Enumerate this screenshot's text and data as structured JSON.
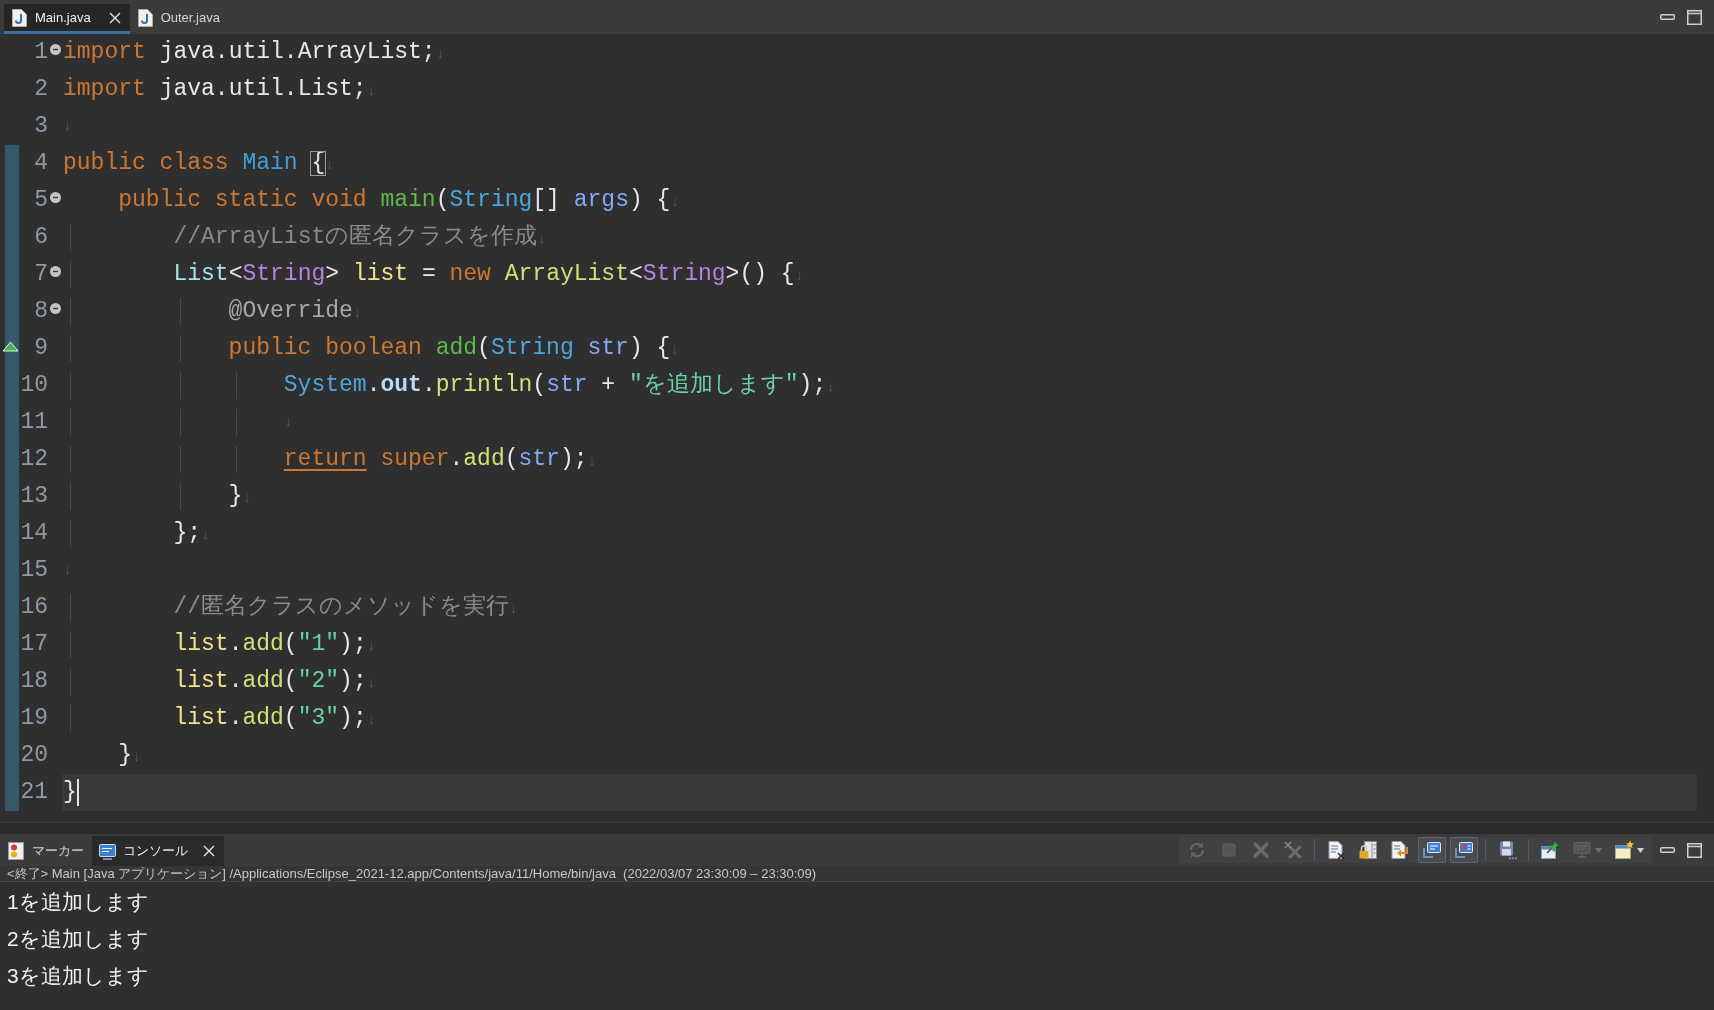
{
  "editor_tabs": [
    {
      "label": "Main.java",
      "selected": true
    },
    {
      "label": "Outer.java",
      "selected": false
    }
  ],
  "editor": {
    "lines": [
      {
        "number": "1",
        "fold": true,
        "override": false,
        "range": false,
        "current": false,
        "tokens": [
          {
            "kind": "keyword",
            "text": "import"
          },
          {
            "kind": "plain",
            "text": " java.util.ArrayList;"
          },
          {
            "kind": "eol",
            "text": "↓"
          }
        ]
      },
      {
        "number": "2",
        "fold": false,
        "override": false,
        "range": false,
        "current": false,
        "tokens": [
          {
            "kind": "keyword",
            "text": "import"
          },
          {
            "kind": "plain",
            "text": " java.util.List;"
          },
          {
            "kind": "eol",
            "text": "↓"
          }
        ]
      },
      {
        "number": "3",
        "fold": false,
        "override": false,
        "range": false,
        "current": false,
        "tokens": [
          {
            "kind": "eol",
            "text": "↓"
          }
        ]
      },
      {
        "number": "4",
        "fold": false,
        "override": false,
        "range": true,
        "current": false,
        "tokens": [
          {
            "kind": "keyword",
            "text": "public class "
          },
          {
            "kind": "class_name",
            "text": "Main "
          },
          {
            "kind": "bracket_match",
            "text": "{"
          },
          {
            "kind": "eol",
            "text": "↓"
          }
        ]
      },
      {
        "number": "5",
        "fold": true,
        "override": false,
        "range": true,
        "current": false,
        "indent_guides": [
          false
        ],
        "tokens": [
          {
            "kind": "keyword",
            "text": "public static void "
          },
          {
            "kind": "method_decl",
            "text": "main"
          },
          {
            "kind": "plain",
            "text": "("
          },
          {
            "kind": "type",
            "text": "String"
          },
          {
            "kind": "plain",
            "text": "[] "
          },
          {
            "kind": "param",
            "text": "args"
          },
          {
            "kind": "plain",
            "text": ") {"
          },
          {
            "kind": "eol",
            "text": "↓"
          }
        ]
      },
      {
        "number": "6",
        "fold": false,
        "override": false,
        "range": true,
        "current": false,
        "indent_guides": [
          true,
          false
        ],
        "tokens": [
          {
            "kind": "comment",
            "text": "//ArrayListの匿名クラスを作成"
          },
          {
            "kind": "eol",
            "text": "↓"
          }
        ]
      },
      {
        "number": "7",
        "fold": true,
        "override": false,
        "range": true,
        "current": false,
        "indent_guides": [
          true,
          false
        ],
        "tokens": [
          {
            "kind": "local_type",
            "text": "List"
          },
          {
            "kind": "plain",
            "text": "<"
          },
          {
            "kind": "generic",
            "text": "String"
          },
          {
            "kind": "plain",
            "text": "> "
          },
          {
            "kind": "local_var",
            "text": "list"
          },
          {
            "kind": "plain",
            "text": " = "
          },
          {
            "kind": "keyword",
            "text": "new "
          },
          {
            "kind": "constructor",
            "text": "ArrayList"
          },
          {
            "kind": "plain",
            "text": "<"
          },
          {
            "kind": "generic",
            "text": "String"
          },
          {
            "kind": "plain",
            "text": ">() {"
          },
          {
            "kind": "eol",
            "text": "↓"
          }
        ]
      },
      {
        "number": "8",
        "fold": true,
        "override": false,
        "range": true,
        "current": false,
        "indent_guides": [
          true,
          false,
          true
        ],
        "tokens": [
          {
            "kind": "annotation",
            "text": "@Override"
          },
          {
            "kind": "eol",
            "text": "↓"
          }
        ]
      },
      {
        "number": "9",
        "fold": false,
        "override": true,
        "range": true,
        "current": false,
        "indent_guides": [
          true,
          false,
          true
        ],
        "tokens": [
          {
            "kind": "keyword",
            "text": "public boolean "
          },
          {
            "kind": "method_decl",
            "text": "add"
          },
          {
            "kind": "plain",
            "text": "("
          },
          {
            "kind": "type",
            "text": "String "
          },
          {
            "kind": "param",
            "text": "str"
          },
          {
            "kind": "plain",
            "text": ") {"
          },
          {
            "kind": "eol",
            "text": "↓"
          }
        ]
      },
      {
        "number": "10",
        "fold": false,
        "override": false,
        "range": true,
        "current": false,
        "indent_guides": [
          true,
          false,
          true,
          true
        ],
        "tokens": [
          {
            "kind": "type",
            "text": "System"
          },
          {
            "kind": "plain",
            "text": "."
          },
          {
            "kind": "field",
            "text": "out"
          },
          {
            "kind": "plain",
            "text": "."
          },
          {
            "kind": "method_call",
            "text": "println"
          },
          {
            "kind": "plain",
            "text": "("
          },
          {
            "kind": "param",
            "text": "str"
          },
          {
            "kind": "plain",
            "text": " + "
          },
          {
            "kind": "string",
            "text": "\"を追加します\""
          },
          {
            "kind": "plain",
            "text": ");"
          },
          {
            "kind": "eol",
            "text": "↓"
          }
        ]
      },
      {
        "number": "11",
        "fold": false,
        "override": false,
        "range": true,
        "current": false,
        "indent_guides": [
          true,
          false,
          true,
          true
        ],
        "tokens": [
          {
            "kind": "eol",
            "text": "↓"
          }
        ]
      },
      {
        "number": "12",
        "fold": false,
        "override": false,
        "range": true,
        "current": false,
        "indent_guides": [
          true,
          false,
          true,
          true
        ],
        "tokens": [
          {
            "kind": "return_keyword",
            "text": "return"
          },
          {
            "kind": "keyword",
            "text": " super"
          },
          {
            "kind": "plain",
            "text": "."
          },
          {
            "kind": "method_call",
            "text": "add"
          },
          {
            "kind": "plain",
            "text": "("
          },
          {
            "kind": "param",
            "text": "str"
          },
          {
            "kind": "plain",
            "text": ");"
          },
          {
            "kind": "eol",
            "text": "↓"
          }
        ]
      },
      {
        "number": "13",
        "fold": false,
        "override": false,
        "range": true,
        "current": false,
        "indent_guides": [
          true,
          false,
          true
        ],
        "tokens": [
          {
            "kind": "plain",
            "text": "}"
          },
          {
            "kind": "eol",
            "text": "↓"
          }
        ]
      },
      {
        "number": "14",
        "fold": false,
        "override": false,
        "range": true,
        "current": false,
        "indent_guides": [
          true,
          false
        ],
        "tokens": [
          {
            "kind": "plain",
            "text": "};"
          },
          {
            "kind": "eol",
            "text": "↓"
          }
        ]
      },
      {
        "number": "15",
        "fold": false,
        "override": false,
        "range": true,
        "current": false,
        "tokens": [
          {
            "kind": "eol",
            "text": "↓"
          }
        ]
      },
      {
        "number": "16",
        "fold": false,
        "override": false,
        "range": true,
        "current": false,
        "indent_guides": [
          true,
          false
        ],
        "tokens": [
          {
            "kind": "comment",
            "text": "//匿名クラスのメソッドを実行"
          },
          {
            "kind": "eol",
            "text": "↓"
          }
        ]
      },
      {
        "number": "17",
        "fold": false,
        "override": false,
        "range": true,
        "current": false,
        "indent_guides": [
          true,
          false
        ],
        "tokens": [
          {
            "kind": "local_var",
            "text": "list"
          },
          {
            "kind": "plain",
            "text": "."
          },
          {
            "kind": "method_call",
            "text": "add"
          },
          {
            "kind": "plain",
            "text": "("
          },
          {
            "kind": "string",
            "text": "\"1\""
          },
          {
            "kind": "plain",
            "text": ");"
          },
          {
            "kind": "eol",
            "text": "↓"
          }
        ]
      },
      {
        "number": "18",
        "fold": false,
        "override": false,
        "range": true,
        "current": false,
        "indent_guides": [
          true,
          false
        ],
        "tokens": [
          {
            "kind": "local_var",
            "text": "list"
          },
          {
            "kind": "plain",
            "text": "."
          },
          {
            "kind": "method_call",
            "text": "add"
          },
          {
            "kind": "plain",
            "text": "("
          },
          {
            "kind": "string",
            "text": "\"2\""
          },
          {
            "kind": "plain",
            "text": ");"
          },
          {
            "kind": "eol",
            "text": "↓"
          }
        ]
      },
      {
        "number": "19",
        "fold": false,
        "override": false,
        "range": true,
        "current": false,
        "indent_guides": [
          true,
          false
        ],
        "tokens": [
          {
            "kind": "local_var",
            "text": "list"
          },
          {
            "kind": "plain",
            "text": "."
          },
          {
            "kind": "method_call",
            "text": "add"
          },
          {
            "kind": "plain",
            "text": "("
          },
          {
            "kind": "string",
            "text": "\"3\""
          },
          {
            "kind": "plain",
            "text": ");"
          },
          {
            "kind": "eol",
            "text": "↓"
          }
        ]
      },
      {
        "number": "20",
        "fold": false,
        "override": false,
        "range": true,
        "current": false,
        "indent_guides": [
          false
        ],
        "tokens": [
          {
            "kind": "plain",
            "text": "}"
          },
          {
            "kind": "eol",
            "text": "↓"
          }
        ]
      },
      {
        "number": "21",
        "fold": false,
        "override": false,
        "range": true,
        "current": true,
        "tokens": [
          {
            "kind": "plain",
            "text": "}"
          }
        ]
      }
    ]
  },
  "console": {
    "tabs": [
      {
        "kind": "markers",
        "label": "マーカー",
        "selected": false
      },
      {
        "kind": "console",
        "label": "コンソール",
        "selected": true
      }
    ],
    "toolbar": [
      [
        {
          "kind": "relaunch",
          "disabled": true,
          "pressed": false,
          "dropdown": false
        },
        {
          "kind": "terminate",
          "disabled": true,
          "pressed": false,
          "dropdown": false
        },
        {
          "kind": "remove_launch",
          "disabled": true,
          "pressed": false,
          "dropdown": false
        },
        {
          "kind": "remove_all",
          "disabled": true,
          "pressed": false,
          "dropdown": false
        }
      ],
      [
        {
          "kind": "clear",
          "disabled": false,
          "pressed": false,
          "dropdown": false
        },
        {
          "kind": "scroll_lock",
          "disabled": false,
          "pressed": false,
          "dropdown": false
        },
        {
          "kind": "word_wrap",
          "disabled": false,
          "pressed": false,
          "dropdown": false
        },
        {
          "kind": "show_on_output",
          "disabled": false,
          "pressed": true,
          "dropdown": false
        },
        {
          "kind": "show_on_error",
          "disabled": false,
          "pressed": true,
          "dropdown": false
        }
      ],
      [
        {
          "kind": "save",
          "disabled": false,
          "pressed": false,
          "dropdown": false
        }
      ],
      [
        {
          "kind": "pin",
          "disabled": false,
          "pressed": false,
          "dropdown": false
        },
        {
          "kind": "display_console",
          "disabled": true,
          "pressed": false,
          "dropdown": true
        },
        {
          "kind": "open_console",
          "disabled": false,
          "pressed": false,
          "dropdown": true
        }
      ]
    ],
    "header": "<終了> Main [Java アプリケーション] /Applications/Eclipse_2021-12.app/Contents/java/11/Home/bin/java  (2022/03/07 23:30:09 – 23:30:09)",
    "output": [
      "1を追加します",
      "2を追加します",
      "3を追加します"
    ]
  }
}
